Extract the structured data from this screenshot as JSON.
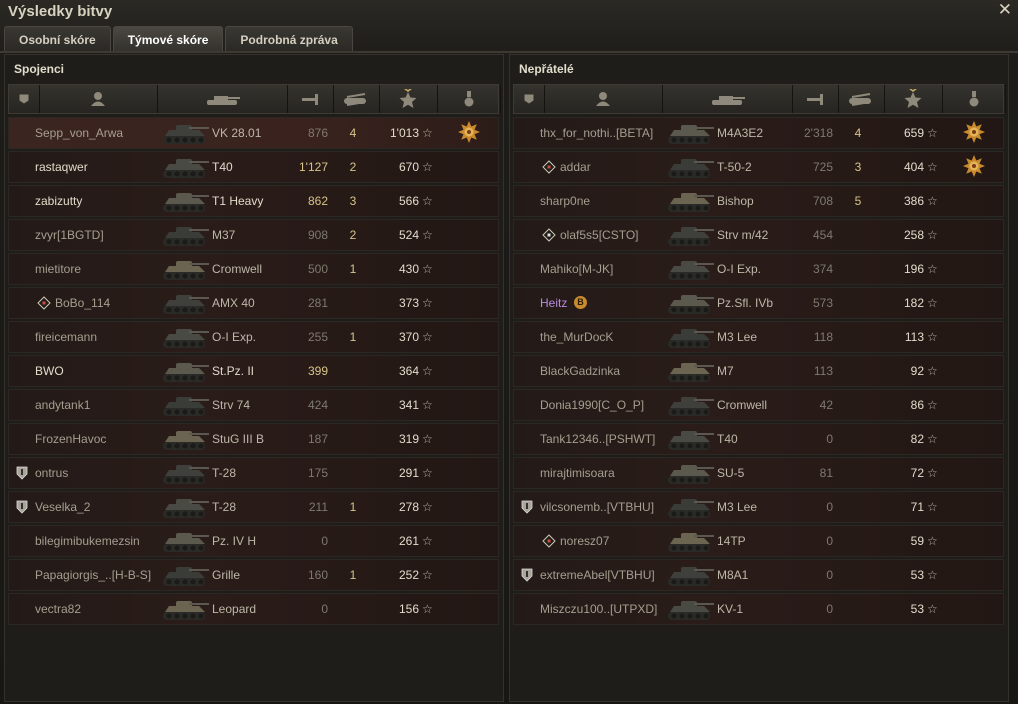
{
  "window": {
    "title": "Výsledky bitvy",
    "close_icon": "close-icon"
  },
  "tabs": [
    {
      "label": "Osobní skóre",
      "active": false
    },
    {
      "label": "Týmové skóre",
      "active": true
    },
    {
      "label": "Podrobná zpráva",
      "active": false
    }
  ],
  "allies": {
    "title": "Spojenci",
    "rows": [
      {
        "name": "Sepp_von_Arwa",
        "tank": "VK 28.01",
        "damage": "876",
        "kills": "4",
        "xp": "1'013",
        "medal": "medal-2",
        "self": true
      },
      {
        "name": "rastaqwer",
        "tank": "T40",
        "damage": "1'127",
        "damage_hi": true,
        "kills": "2",
        "xp": "670",
        "bright": true
      },
      {
        "name": "zabizutty",
        "tank": "T1 Heavy",
        "damage": "862",
        "damage_hi": true,
        "kills": "3",
        "xp": "566",
        "bright": true
      },
      {
        "name": "zvyr[1BGTD]",
        "tank": "M37",
        "damage": "908",
        "kills": "2",
        "xp": "524"
      },
      {
        "name": "mietitore",
        "tank": "Cromwell",
        "damage": "500",
        "kills": "1",
        "xp": "430"
      },
      {
        "name": "BoBo_114",
        "tank": "AMX 40",
        "damage": "281",
        "kills": "",
        "xp": "373",
        "icon": "diamond"
      },
      {
        "name": "fireicemann",
        "tank": "O-I Exp.",
        "damage": "255",
        "kills": "1",
        "xp": "370"
      },
      {
        "name": "BWO",
        "tank": "St.Pz. II",
        "damage": "399",
        "damage_hi": true,
        "kills": "",
        "xp": "364",
        "bright": true
      },
      {
        "name": "andytank1",
        "tank": "Strv 74",
        "damage": "424",
        "kills": "",
        "xp": "341"
      },
      {
        "name": "FrozenHavoc",
        "tank": "StuG III B",
        "damage": "187",
        "kills": "",
        "xp": "319"
      },
      {
        "name": "ontrus",
        "tank": "T-28",
        "damage": "175",
        "kills": "",
        "xp": "291",
        "icon": "shield"
      },
      {
        "name": "Veselka_2",
        "tank": "T-28",
        "damage": "211",
        "kills": "1",
        "xp": "278",
        "icon": "shield"
      },
      {
        "name": "bilegimibukemezsin",
        "tank": "Pz. IV H",
        "damage": "0",
        "kills": "",
        "xp": "261"
      },
      {
        "name": "Papagiorgis_..[H-B-S]",
        "tank": "Grille",
        "damage": "160",
        "kills": "1",
        "xp": "252"
      },
      {
        "name": "vectra82",
        "tank": "Leopard",
        "damage": "0",
        "kills": "",
        "xp": "156"
      }
    ]
  },
  "enemies": {
    "title": "Nepřátelé",
    "rows": [
      {
        "name": "thx_for_nothi..[BETA]",
        "tank": "M4A3E2",
        "damage": "2'318",
        "kills": "4",
        "xp": "659",
        "medal": "medal"
      },
      {
        "name": "addar",
        "tank": "T-50-2",
        "damage": "725",
        "kills": "3",
        "xp": "404",
        "medal": "medal",
        "icon": "diamond2"
      },
      {
        "name": "sharp0ne",
        "tank": "Bishop",
        "damage": "708",
        "kills": "5",
        "xp": "386"
      },
      {
        "name": "olaf5s5[CSTO]",
        "tank": "Strv m/42",
        "damage": "454",
        "kills": "",
        "xp": "258",
        "icon": "diamond2w"
      },
      {
        "name": "Mahiko[M-JK]",
        "tank": "O-I Exp.",
        "damage": "374",
        "kills": "",
        "xp": "196"
      },
      {
        "name": "Heitz",
        "tank": "Pz.Sfl. IVb",
        "damage": "573",
        "kills": "",
        "xp": "182",
        "platoon": true,
        "badge": "B"
      },
      {
        "name": "the_MurDocK",
        "tank": "M3 Lee",
        "damage": "118",
        "kills": "",
        "xp": "113"
      },
      {
        "name": "BlackGadzinka",
        "tank": "M7",
        "damage": "113",
        "kills": "",
        "xp": "92"
      },
      {
        "name": "Donia1990[C_O_P]",
        "tank": "Cromwell",
        "damage": "42",
        "kills": "",
        "xp": "86"
      },
      {
        "name": "Tank12346..[PSHWT]",
        "tank": "T40",
        "damage": "0",
        "kills": "",
        "xp": "82"
      },
      {
        "name": "mirajtimisoara",
        "tank": "SU-5",
        "damage": "81",
        "kills": "",
        "xp": "72"
      },
      {
        "name": "vilcsonemb..[VTBHU]",
        "tank": "M3 Lee",
        "damage": "0",
        "kills": "",
        "xp": "71",
        "icon": "shield"
      },
      {
        "name": "noresz07",
        "tank": "14TP",
        "damage": "0",
        "kills": "",
        "xp": "59",
        "icon": "diamond2"
      },
      {
        "name": "extremeAbel[VTBHU]",
        "tank": "M8A1",
        "damage": "0",
        "kills": "",
        "xp": "53",
        "icon": "shield"
      },
      {
        "name": "Miszczu100..[UTPXD]",
        "tank": "KV-1",
        "damage": "0",
        "kills": "",
        "xp": "53"
      }
    ]
  },
  "star_glyph": "☆"
}
